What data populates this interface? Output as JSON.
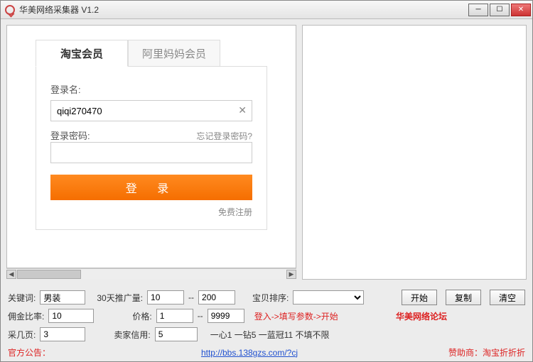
{
  "window": {
    "title": "华美网络采集器 V1.2"
  },
  "tabs": {
    "taobao": "淘宝会员",
    "alimama": "阿里妈妈会员"
  },
  "login": {
    "username_label": "登录名:",
    "username_value": "qiqi270470",
    "password_label": "登录密码:",
    "password_value": "",
    "forgot": "忘记登录密码?",
    "login_btn": "登 录",
    "free_register": "免费注册"
  },
  "params": {
    "keyword_label": "关键词:",
    "keyword_value": "男装",
    "promo_label": "30天推广量:",
    "promo_min": "10",
    "promo_sep": "--",
    "promo_max": "200",
    "sort_label": "宝贝排序:",
    "sort_value": "",
    "start_btn": "开始",
    "copy_btn": "复制",
    "clear_btn": "清空",
    "rate_label": "佣金比率:",
    "rate_value": "10",
    "price_label": "价格:",
    "price_min": "1",
    "price_sep": "--",
    "price_max": "9999",
    "hint": "登入->填写参数->开始",
    "forum": "华美网络论坛",
    "pages_label": "采几页:",
    "pages_value": "3",
    "credit_label": "卖家信用:",
    "credit_value": "5",
    "credit_note": "一心1 一钻5 一蓝冠11 不填不限"
  },
  "footer": {
    "notice_label": "官方公告：",
    "url": "http://bbs.138gzs.com/?cj",
    "sponsor": "赞助商：淘宝折折折"
  }
}
